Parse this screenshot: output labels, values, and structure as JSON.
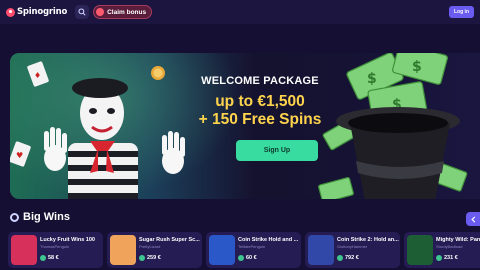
{
  "header": {
    "logo_text": "Spinogrino",
    "claim_bonus_label": "Claim bonus",
    "login_label": "Log in"
  },
  "banner": {
    "welcome": "WELCOME PACKAGE",
    "offer_line1": "up to €1,500",
    "offer_line2": "+ 150 Free Spins",
    "signup_label": "Sign Up"
  },
  "big_wins": {
    "title": "Big Wins",
    "items": [
      {
        "game": "Lucky Fruit Wins 100",
        "user": "ThomasPenguin",
        "amount": "58 €",
        "thumb_color": "#d7305a"
      },
      {
        "game": "Sugar Rush Super Sc...",
        "user": "PrettyLizard",
        "amount": "259 €",
        "thumb_color": "#f0a35a"
      },
      {
        "game": "Coin Strike Hold and ...",
        "user": "TelltalePenguin",
        "amount": "60 €",
        "thumb_color": "#2a58c8"
      },
      {
        "game": "Coin Strike 2: Hold an...",
        "user": "GluttonyHammer",
        "amount": "792 €",
        "thumb_color": "#3148a8"
      },
      {
        "game": "Mighty Wild: Pan...",
        "user": "SturdyBadtoad",
        "amount": "231 €",
        "thumb_color": "#1d5e35"
      }
    ]
  },
  "icons": {
    "search": "search-icon",
    "gift": "gift-icon",
    "trophy": "trophy-icon",
    "arrow": "chevron-left-icon",
    "coin": "coin-icon"
  },
  "colors": {
    "background": "#140f33",
    "accent": "#6a5cf0",
    "signup": "#38dba0",
    "offer": "#ffd44d"
  }
}
